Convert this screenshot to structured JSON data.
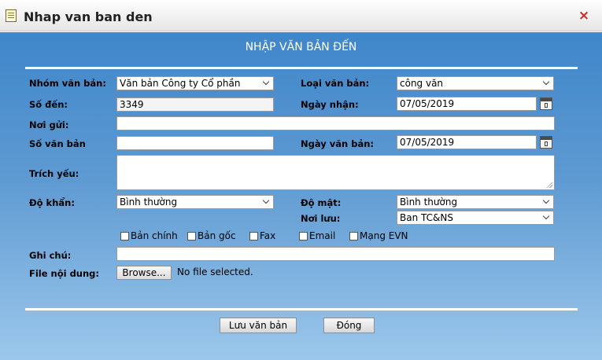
{
  "window": {
    "title": "Nhap van ban den",
    "close_glyph": "×",
    "icon": "note-icon",
    "close_color": "#d42b1e"
  },
  "form": {
    "heading": "NHẬP VĂN BẢN ĐẾN",
    "labels": {
      "nhom_van_ban": "Nhóm văn bản:",
      "loai_van_ban": "Loại văn bản:",
      "so_den": "Số đến:",
      "ngay_nhan": "Ngày nhận:",
      "noi_gui": "Nơi gửi:",
      "so_van_ban": "Số văn bản",
      "ngay_van_ban": "Ngày văn bản:",
      "trich_yeu": "Trích yếu:",
      "do_khan": "Độ khẩn:",
      "do_mat": "Độ mật:",
      "noi_luu": "Nơi lưu:",
      "ghi_chu": "Ghi chú:",
      "file_noi_dung": "File nội dung:"
    },
    "values": {
      "nhom_van_ban": "Văn bản Công ty Cổ phần",
      "loai_van_ban": "công văn",
      "so_den": "3349",
      "ngay_nhan": "07/05/2019",
      "noi_gui": "",
      "so_van_ban": "",
      "ngay_van_ban": "07/05/2019",
      "trich_yeu": "",
      "do_khan": "Bình thường",
      "do_mat": "Bình thường",
      "noi_luu": "Ban TC&NS",
      "ghi_chu": ""
    },
    "checkboxes": [
      {
        "label": "Bản chính",
        "checked": false
      },
      {
        "label": "Bản gốc",
        "checked": false
      },
      {
        "label": "Fax",
        "checked": false
      },
      {
        "label": "Email",
        "checked": false
      },
      {
        "label": "Mạng EVN",
        "checked": false
      }
    ],
    "file": {
      "browse_label": "Browse...",
      "status": "No file selected."
    },
    "buttons": {
      "save": "Lưu văn bản",
      "close": "Đóng"
    }
  },
  "colors": {
    "panel_top": "#3f86ca",
    "panel_bottom": "#9cc7eb",
    "heading_text": "#ffffff"
  }
}
